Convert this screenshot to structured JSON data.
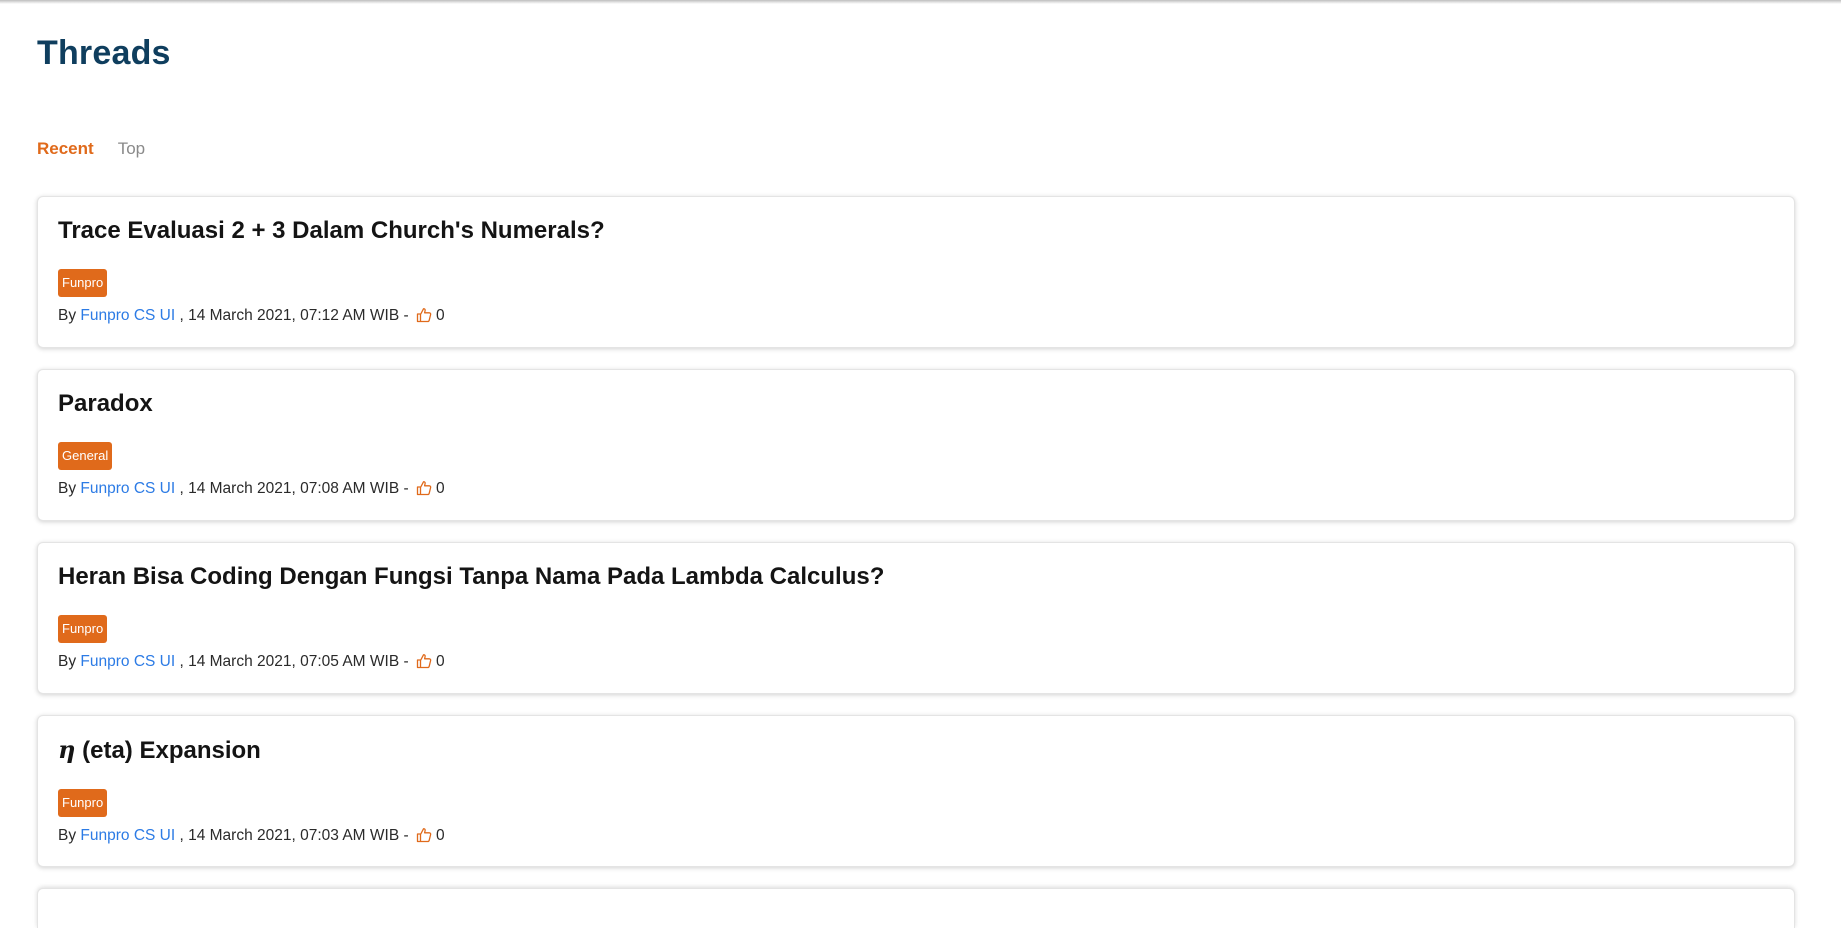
{
  "header": {
    "title": "Threads"
  },
  "tabs": [
    {
      "label": "Recent",
      "active": true
    },
    {
      "label": "Top",
      "active": false
    }
  ],
  "colors": {
    "accent": "#e06a1b",
    "title": "#0f3e5e",
    "link": "#2c7be5"
  },
  "threads": [
    {
      "title": "Trace Evaluasi 2 + 3 Dalam Church's Numerals?",
      "tag": "Funpro",
      "by": "By ",
      "author": "Funpro CS UI",
      "date": " , 14 March 2021, 07:12 AM WIB - ",
      "likes": "0"
    },
    {
      "title": "Paradox",
      "tag": "General",
      "by": "By ",
      "author": "Funpro CS UI",
      "date": " , 14 March 2021, 07:08 AM WIB - ",
      "likes": "0"
    },
    {
      "title": "Heran Bisa Coding Dengan Fungsi Tanpa Nama Pada Lambda Calculus?",
      "tag": "Funpro",
      "by": "By ",
      "author": "Funpro CS UI",
      "date": " , 14 March 2021, 07:05 AM WIB - ",
      "likes": "0"
    },
    {
      "title_symbol": "η",
      "title": " (eta) Expansion",
      "tag": "Funpro",
      "by": "By ",
      "author": "Funpro CS UI",
      "date": " , 14 March 2021, 07:03 AM WIB - ",
      "likes": "0"
    }
  ],
  "icons": {
    "like": "thumbs-up-icon"
  }
}
